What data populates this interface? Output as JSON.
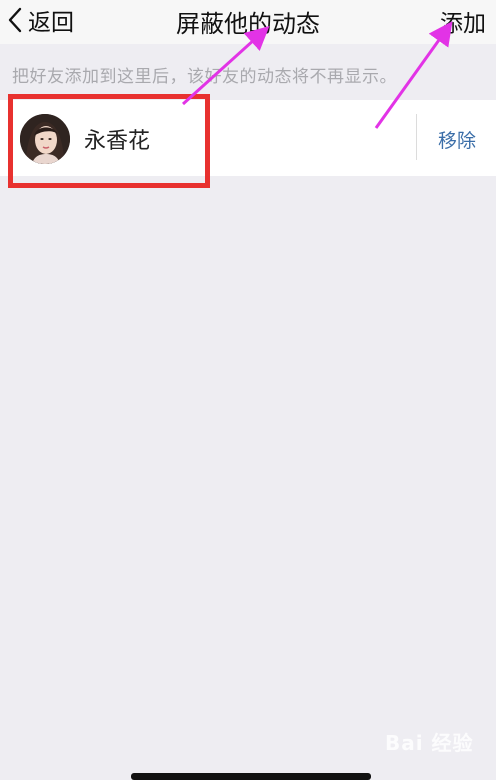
{
  "navbar": {
    "back_label": "返回",
    "title": "屏蔽他的动态",
    "add_label": "添加"
  },
  "hint": "把好友添加到这里后，该好友的动态将不再显示。",
  "blocked_list": [
    {
      "name": "永香花",
      "remove_label": "移除"
    }
  ],
  "watermark": "Bai 经验",
  "colors": {
    "page_background": "#eeedf2",
    "navbar_background": "#f7f7f7",
    "remove_link": "#3b6ea8",
    "highlight_box": "#e8312f",
    "annotation_arrow": "#e233e6"
  }
}
